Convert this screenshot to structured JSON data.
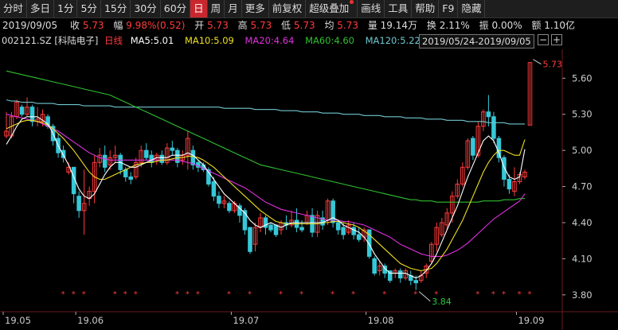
{
  "toolbar": {
    "items": [
      "分时",
      "多日",
      "1分",
      "5分",
      "15分",
      "30分",
      "60分",
      "日",
      "周",
      "月",
      "更多",
      "前复权",
      "超级叠加",
      "画线",
      "工具",
      "帮助",
      "F9",
      "隐藏"
    ],
    "active_index": 7
  },
  "info": {
    "date": "2019/09/05",
    "close_label": "收",
    "close": "5.73",
    "change_label": "幅",
    "change": "9.98%(0.52)",
    "open_label": "开",
    "open": "5.73",
    "high_label": "高",
    "high": "5.73",
    "low_label": "低",
    "low": "5.73",
    "avg_label": "均",
    "avg": "5.73",
    "volume_label": "量",
    "volume": "19.14万",
    "turnover_label": "换",
    "turnover": "2.11%",
    "amplitude_label": "振",
    "amplitude": "0.00%",
    "amount_label": "额",
    "amount": "1.10亿"
  },
  "ma_bar": {
    "code": "002121.SZ",
    "name": "[科陆电子]",
    "period": "日线",
    "ma5": "MA5:5.01",
    "ma10": "MA10:5.09",
    "ma20": "MA20:4.64",
    "ma60": "MA60:4.60",
    "ma120": "MA120:5.22",
    "date_range": "2019/05/24-2019/09/05",
    "minus": "−",
    "plus": "+"
  },
  "colors": {
    "up": "#ff3c3c",
    "down": "#36c8d8",
    "ma5": "#ffffff",
    "ma10": "#f0e020",
    "ma20": "#e030e0",
    "ma60": "#30c030",
    "ma120": "#70c8d0",
    "active": "#c8272d"
  },
  "chart_data": {
    "type": "candlestick",
    "y_ticks": [
      5.6,
      5.3,
      5.0,
      4.7,
      4.4,
      4.1,
      3.8
    ],
    "ylim": [
      3.66,
      5.84
    ],
    "x_ticks": [
      "19.05",
      "19.06",
      "19.07",
      "19.08",
      "19.09"
    ],
    "annotations": {
      "high": "5.73",
      "low": "3.84"
    },
    "candles": [
      [
        5.12,
        5.16,
        5.1,
        5.32
      ],
      [
        5.12,
        5.28,
        5.1,
        5.32
      ],
      [
        5.28,
        5.4,
        5.26,
        5.42
      ],
      [
        5.36,
        5.3,
        5.28,
        5.38
      ],
      [
        5.3,
        5.36,
        5.28,
        5.44
      ],
      [
        5.36,
        5.24,
        5.2,
        5.38
      ],
      [
        5.24,
        5.26,
        5.2,
        5.36
      ],
      [
        5.24,
        5.3,
        5.2,
        5.34
      ],
      [
        5.28,
        5.2,
        5.18,
        5.3
      ],
      [
        5.2,
        5.08,
        5.04,
        5.22
      ],
      [
        5.1,
        4.98,
        4.94,
        5.14
      ],
      [
        5.0,
        4.94,
        4.9,
        5.04
      ],
      [
        4.82,
        4.86,
        4.8,
        4.9
      ],
      [
        4.86,
        4.64,
        4.56,
        4.86
      ],
      [
        4.62,
        4.5,
        4.44,
        4.66
      ],
      [
        4.5,
        4.56,
        4.3,
        4.84
      ],
      [
        4.6,
        4.66,
        4.54,
        4.7
      ],
      [
        4.66,
        4.9,
        4.56,
        4.96
      ],
      [
        4.9,
        4.96,
        4.86,
        5.02
      ],
      [
        4.96,
        4.86,
        4.82,
        5.04
      ],
      [
        4.88,
        4.94,
        4.84,
        5.0
      ],
      [
        4.94,
        4.96,
        4.9,
        5.04
      ],
      [
        4.96,
        4.84,
        4.8,
        4.98
      ],
      [
        4.84,
        4.78,
        4.74,
        4.86
      ],
      [
        4.78,
        4.76,
        4.72,
        4.82
      ],
      [
        4.78,
        4.9,
        4.76,
        4.94
      ],
      [
        4.9,
        5.0,
        4.86,
        5.04
      ],
      [
        5.0,
        4.94,
        4.92,
        5.06
      ],
      [
        4.96,
        4.9,
        4.86,
        5.0
      ],
      [
        4.92,
        4.96,
        4.88,
        4.98
      ],
      [
        4.96,
        4.9,
        4.88,
        5.0
      ],
      [
        4.9,
        5.02,
        4.88,
        5.06
      ],
      [
        5.02,
        5.0,
        4.96,
        5.08
      ],
      [
        5.0,
        4.9,
        4.86,
        5.02
      ],
      [
        4.92,
        4.96,
        4.88,
        5.0
      ],
      [
        4.96,
        5.1,
        4.84,
        5.16
      ],
      [
        5.0,
        4.88,
        4.84,
        5.04
      ],
      [
        4.9,
        4.86,
        4.82,
        4.92
      ],
      [
        4.88,
        4.84,
        4.82,
        4.9
      ],
      [
        4.84,
        4.72,
        4.7,
        4.86
      ],
      [
        4.74,
        4.62,
        4.58,
        4.78
      ],
      [
        4.62,
        4.56,
        4.52,
        4.66
      ],
      [
        4.56,
        4.58,
        4.52,
        4.62
      ],
      [
        4.56,
        4.5,
        4.48,
        4.58
      ],
      [
        4.5,
        4.56,
        4.48,
        4.58
      ],
      [
        4.54,
        4.46,
        4.4,
        4.56
      ],
      [
        4.5,
        4.34,
        4.3,
        4.52
      ],
      [
        4.36,
        4.16,
        4.14,
        4.36
      ],
      [
        4.22,
        4.36,
        4.16,
        4.4
      ],
      [
        4.36,
        4.44,
        4.32,
        4.48
      ],
      [
        4.44,
        4.36,
        4.3,
        4.46
      ],
      [
        4.38,
        4.34,
        4.32,
        4.4
      ],
      [
        4.38,
        4.3,
        4.28,
        4.38
      ],
      [
        4.34,
        4.4,
        4.3,
        4.42
      ],
      [
        4.4,
        4.38,
        4.34,
        4.46
      ],
      [
        4.38,
        4.42,
        4.36,
        4.5
      ],
      [
        4.42,
        4.36,
        4.32,
        4.52
      ],
      [
        4.36,
        4.34,
        4.32,
        4.42
      ],
      [
        4.4,
        4.46,
        4.38,
        4.5
      ],
      [
        4.46,
        4.32,
        4.28,
        4.52
      ],
      [
        4.32,
        4.46,
        4.28,
        4.5
      ],
      [
        4.44,
        4.38,
        4.34,
        4.5
      ],
      [
        4.42,
        4.58,
        4.38,
        4.6
      ],
      [
        4.58,
        4.4,
        4.36,
        4.6
      ],
      [
        4.4,
        4.34,
        4.3,
        4.42
      ],
      [
        4.36,
        4.3,
        4.26,
        4.4
      ],
      [
        4.32,
        4.38,
        4.3,
        4.42
      ],
      [
        4.36,
        4.3,
        4.26,
        4.4
      ],
      [
        4.3,
        4.26,
        4.24,
        4.36
      ],
      [
        4.28,
        4.34,
        4.24,
        4.36
      ],
      [
        4.34,
        4.12,
        4.1,
        4.34
      ],
      [
        4.1,
        3.98,
        3.96,
        4.12
      ],
      [
        4.0,
        4.04,
        3.96,
        4.08
      ],
      [
        4.04,
        3.98,
        3.94,
        4.06
      ],
      [
        4.0,
        3.92,
        3.9,
        4.0
      ],
      [
        3.98,
        4.0,
        3.94,
        4.02
      ],
      [
        4.0,
        3.94,
        3.9,
        4.02
      ],
      [
        3.94,
        4.0,
        3.92,
        4.02
      ],
      [
        3.96,
        3.92,
        3.88,
        4.0
      ],
      [
        3.92,
        3.9,
        3.84,
        3.96
      ],
      [
        3.92,
        3.96,
        3.9,
        4.0
      ],
      [
        3.98,
        4.04,
        3.94,
        4.06
      ],
      [
        4.08,
        4.22,
        4.06,
        4.24
      ],
      [
        4.22,
        4.36,
        4.16,
        4.4
      ],
      [
        4.3,
        4.4,
        4.28,
        4.44
      ],
      [
        4.38,
        4.48,
        4.34,
        4.52
      ],
      [
        4.48,
        4.62,
        4.4,
        4.66
      ],
      [
        4.62,
        4.72,
        4.6,
        4.76
      ],
      [
        4.72,
        4.86,
        4.7,
        4.9
      ],
      [
        4.86,
        5.08,
        4.84,
        5.1
      ],
      [
        5.1,
        4.96,
        4.92,
        5.12
      ],
      [
        4.96,
        5.2,
        4.94,
        5.24
      ],
      [
        5.2,
        5.32,
        5.16,
        5.34
      ],
      [
        5.32,
        5.28,
        5.2,
        5.46
      ],
      [
        5.28,
        5.1,
        5.06,
        5.32
      ],
      [
        5.1,
        4.94,
        4.9,
        5.12
      ],
      [
        4.94,
        4.76,
        4.7,
        4.96
      ],
      [
        4.76,
        4.68,
        4.64,
        4.8
      ],
      [
        4.66,
        4.74,
        4.62,
        4.86
      ],
      [
        4.74,
        4.8,
        4.72,
        4.82
      ],
      [
        4.78,
        4.82,
        4.76,
        4.84
      ],
      [
        5.21,
        5.73,
        5.21,
        5.73
      ]
    ],
    "ma5": [
      5.05,
      5.12,
      5.2,
      5.26,
      5.28,
      5.28,
      5.28,
      5.25,
      5.22,
      5.14,
      5.04,
      4.96,
      4.88,
      4.78,
      4.68,
      4.62,
      4.6,
      4.64,
      4.72,
      4.8,
      4.86,
      4.9,
      4.9,
      4.88,
      4.86,
      4.86,
      4.88,
      4.9,
      4.92,
      4.94,
      4.94,
      4.94,
      4.96,
      4.96,
      4.96,
      4.98,
      4.96,
      4.92,
      4.88,
      4.82,
      4.76,
      4.7,
      4.64,
      4.6,
      4.56,
      4.52,
      4.48,
      4.42,
      4.38,
      4.36,
      4.38,
      4.4,
      4.38,
      4.36,
      4.38,
      4.4,
      4.4,
      4.4,
      4.4,
      4.4,
      4.4,
      4.4,
      4.42,
      4.44,
      4.42,
      4.38,
      4.36,
      4.34,
      4.32,
      4.28,
      4.22,
      4.14,
      4.08,
      4.02,
      3.98,
      3.98,
      3.98,
      3.98,
      3.96,
      3.94,
      3.96,
      4.0,
      4.06,
      4.14,
      4.24,
      4.34,
      4.44,
      4.54,
      4.66,
      4.78,
      4.88,
      4.98,
      5.08,
      5.12,
      5.08,
      4.98,
      4.86,
      4.78,
      4.76,
      4.78,
      5.01
    ],
    "ma10": [
      5.18,
      5.2,
      5.22,
      5.24,
      5.25,
      5.25,
      5.24,
      5.23,
      5.21,
      5.18,
      5.14,
      5.1,
      5.05,
      5.0,
      4.94,
      4.88,
      4.82,
      4.78,
      4.76,
      4.76,
      4.78,
      4.8,
      4.82,
      4.84,
      4.86,
      4.88,
      4.89,
      4.9,
      4.9,
      4.91,
      4.92,
      4.92,
      4.93,
      4.94,
      4.94,
      4.95,
      4.95,
      4.94,
      4.92,
      4.89,
      4.86,
      4.82,
      4.78,
      4.74,
      4.7,
      4.66,
      4.62,
      4.58,
      4.54,
      4.5,
      4.47,
      4.44,
      4.41,
      4.4,
      4.39,
      4.39,
      4.39,
      4.39,
      4.39,
      4.39,
      4.39,
      4.4,
      4.4,
      4.41,
      4.41,
      4.4,
      4.39,
      4.38,
      4.36,
      4.33,
      4.3,
      4.26,
      4.22,
      4.18,
      4.14,
      4.1,
      4.06,
      4.04,
      4.02,
      4.01,
      4.0,
      4.01,
      4.02,
      4.06,
      4.12,
      4.18,
      4.26,
      4.34,
      4.42,
      4.52,
      4.62,
      4.72,
      4.82,
      4.9,
      4.96,
      5.0,
      5.0,
      4.98,
      4.96,
      4.96,
      5.09
    ],
    "ma20": [
      5.3,
      5.29,
      5.28,
      5.27,
      5.26,
      5.25,
      5.24,
      5.22,
      5.2,
      5.18,
      5.16,
      5.13,
      5.1,
      5.07,
      5.04,
      5.01,
      4.98,
      4.96,
      4.94,
      4.93,
      4.92,
      4.92,
      4.92,
      4.92,
      4.92,
      4.92,
      4.92,
      4.92,
      4.92,
      4.92,
      4.92,
      4.92,
      4.92,
      4.92,
      4.91,
      4.9,
      4.89,
      4.87,
      4.85,
      4.83,
      4.81,
      4.79,
      4.77,
      4.75,
      4.73,
      4.71,
      4.69,
      4.66,
      4.63,
      4.6,
      4.57,
      4.55,
      4.53,
      4.51,
      4.5,
      4.49,
      4.48,
      4.47,
      4.46,
      4.45,
      4.44,
      4.43,
      4.42,
      4.42,
      4.42,
      4.41,
      4.41,
      4.4,
      4.39,
      4.38,
      4.36,
      4.34,
      4.32,
      4.3,
      4.28,
      4.25,
      4.22,
      4.2,
      4.18,
      4.16,
      4.14,
      4.13,
      4.12,
      4.12,
      4.12,
      4.13,
      4.15,
      4.17,
      4.2,
      4.23,
      4.27,
      4.31,
      4.35,
      4.39,
      4.43,
      4.46,
      4.49,
      4.52,
      4.55,
      4.58,
      4.64
    ],
    "ma60": [
      5.66,
      5.65,
      5.64,
      5.63,
      5.62,
      5.61,
      5.6,
      5.59,
      5.58,
      5.57,
      5.56,
      5.55,
      5.54,
      5.53,
      5.52,
      5.51,
      5.5,
      5.49,
      5.48,
      5.47,
      5.46,
      5.44,
      5.42,
      5.4,
      5.38,
      5.36,
      5.34,
      5.32,
      5.3,
      5.28,
      5.26,
      5.24,
      5.22,
      5.2,
      5.18,
      5.16,
      5.14,
      5.12,
      5.1,
      5.08,
      5.06,
      5.04,
      5.02,
      5.0,
      4.98,
      4.96,
      4.94,
      4.92,
      4.9,
      4.88,
      4.87,
      4.86,
      4.85,
      4.84,
      4.83,
      4.82,
      4.81,
      4.8,
      4.79,
      4.78,
      4.77,
      4.76,
      4.75,
      4.74,
      4.73,
      4.72,
      4.71,
      4.7,
      4.69,
      4.68,
      4.67,
      4.66,
      4.65,
      4.64,
      4.63,
      4.62,
      4.61,
      4.6,
      4.59,
      4.59,
      4.58,
      4.58,
      4.58,
      4.57,
      4.57,
      4.57,
      4.57,
      4.57,
      4.57,
      4.57,
      4.57,
      4.57,
      4.58,
      4.58,
      4.58,
      4.58,
      4.59,
      4.59,
      4.59,
      4.6,
      4.6
    ],
    "ma120": [
      5.42,
      5.41,
      5.41,
      5.4,
      5.4,
      5.4,
      5.39,
      5.39,
      5.39,
      5.39,
      5.38,
      5.38,
      5.38,
      5.38,
      5.38,
      5.37,
      5.37,
      5.37,
      5.37,
      5.37,
      5.37,
      5.36,
      5.36,
      5.36,
      5.36,
      5.36,
      5.36,
      5.36,
      5.36,
      5.36,
      5.36,
      5.36,
      5.36,
      5.36,
      5.36,
      5.36,
      5.36,
      5.36,
      5.36,
      5.36,
      5.36,
      5.36,
      5.35,
      5.35,
      5.35,
      5.35,
      5.35,
      5.35,
      5.34,
      5.34,
      5.34,
      5.34,
      5.34,
      5.33,
      5.33,
      5.33,
      5.33,
      5.32,
      5.32,
      5.32,
      5.32,
      5.31,
      5.31,
      5.31,
      5.31,
      5.3,
      5.3,
      5.3,
      5.3,
      5.29,
      5.29,
      5.29,
      5.29,
      5.28,
      5.28,
      5.28,
      5.28,
      5.27,
      5.27,
      5.27,
      5.27,
      5.26,
      5.26,
      5.26,
      5.26,
      5.25,
      5.25,
      5.25,
      5.25,
      5.24,
      5.24,
      5.24,
      5.24,
      5.23,
      5.23,
      5.23,
      5.23,
      5.22,
      5.22,
      5.22,
      5.22
    ],
    "star_indices": [
      11,
      13,
      15,
      21,
      23,
      25,
      33,
      35,
      37,
      43,
      47,
      53,
      57,
      63,
      67,
      73,
      79,
      83,
      91,
      94,
      96,
      99,
      101
    ]
  }
}
